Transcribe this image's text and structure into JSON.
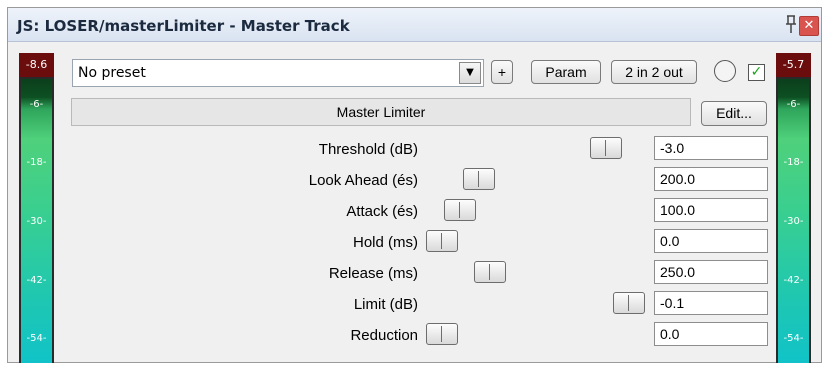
{
  "window": {
    "title": "JS: LOSER/masterLimiter - Master Track",
    "close_label": "✕"
  },
  "meters": {
    "left": {
      "peak": "-8.6",
      "ticks": [
        "-6-",
        "-18-",
        "-30-",
        "-42-",
        "-54-"
      ]
    },
    "right": {
      "peak": "-5.7",
      "ticks": [
        "-6-",
        "-18-",
        "-30-",
        "-42-",
        "-54-"
      ]
    }
  },
  "toolbar": {
    "preset_value": "No preset",
    "add_label": "+",
    "param_label": "Param",
    "io_label": "2 in 2 out",
    "bypass_checked": "✓"
  },
  "plugin": {
    "name": "Master Limiter",
    "edit_label": "Edit..."
  },
  "params": [
    {
      "label": "Threshold (dB)",
      "value": "-3.0"
    },
    {
      "label": "Look Ahead (és)",
      "value": "200.0"
    },
    {
      "label": "Attack (és)",
      "value": "100.0"
    },
    {
      "label": "Hold (ms)",
      "value": "0.0"
    },
    {
      "label": "Release (ms)",
      "value": "250.0"
    },
    {
      "label": "Limit (dB)",
      "value": "-0.1"
    },
    {
      "label": "Reduction",
      "value": "0.0"
    }
  ]
}
